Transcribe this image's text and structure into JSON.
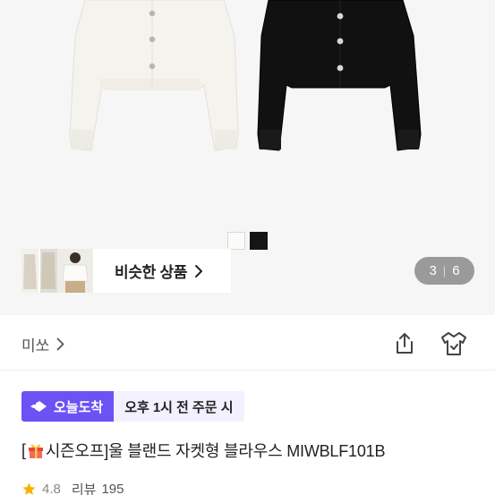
{
  "similar": {
    "label": "비슷한 상품"
  },
  "gallery": {
    "current": "3",
    "total": "6"
  },
  "swatches": [
    {
      "name": "white",
      "color": "#fbfbf8"
    },
    {
      "name": "black",
      "color": "#151515"
    }
  ],
  "brand": {
    "name": "미쏘"
  },
  "delivery": {
    "badge": "오늘도착",
    "text_before": "오후",
    "time": "1시",
    "text_after": "전 주문 시",
    "accent": "#6b52f5"
  },
  "product": {
    "title_open": "[",
    "title_icon": "gift-icon",
    "title_tag": "시즌오프]",
    "title_rest": "울 블랜드 자켓형 블라우스 MIWBLF101B"
  },
  "rating": {
    "score": "4.8",
    "reviews_label": "리뷰",
    "reviews_count": "195",
    "star_color": "#f5b200"
  }
}
